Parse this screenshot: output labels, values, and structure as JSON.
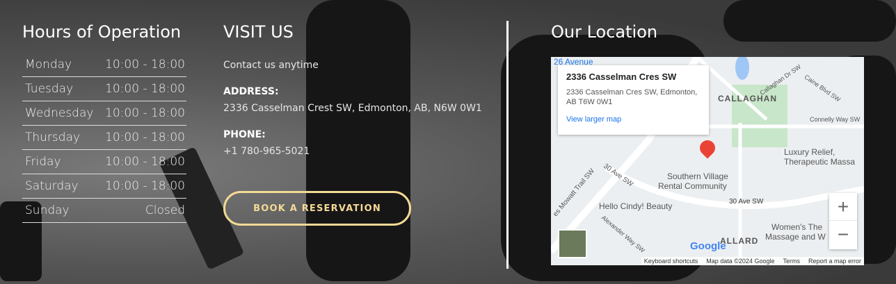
{
  "hours": {
    "title": "Hours of Operation",
    "rows": [
      {
        "day": "Monday",
        "time": "10:00 - 18:00"
      },
      {
        "day": "Tuesday",
        "time": "10:00 - 18:00"
      },
      {
        "day": "Wednesday",
        "time": "10:00 - 18:00"
      },
      {
        "day": "Thursday",
        "time": "10:00 - 18:00"
      },
      {
        "day": "Friday",
        "time": "10:00 - 18:00"
      },
      {
        "day": "Saturday",
        "time": "10:00 - 18:00"
      },
      {
        "day": "Sunday",
        "time": "Closed"
      }
    ]
  },
  "visit": {
    "title": "VISIT US",
    "subtitle": "Contact us anytime",
    "address_label": "ADDRESS:",
    "address": "2336 Casselman Crest SW, Edmonton, AB, N6W 0W1",
    "phone_label": "PHONE:",
    "phone": "+1 780-965-5021",
    "button": "BOOK A RESERVATION",
    "accent": "#f5d995"
  },
  "location": {
    "title": "Our Location",
    "map": {
      "card_title": "2336 Casselman Cres SW",
      "card_address_1": "2336 Casselman Cres SW, Edmonton,",
      "card_address_2": "AB T6W 0W1",
      "view_larger": "View larger map",
      "labels": [
        "26 Avenue",
        "CALLAGHAN",
        "Callaghan Dr SW",
        "Caine Blvd SW",
        "Connelly Way SW",
        "Luxury Relief,",
        "Therapeutic Massa",
        "Southern Village",
        "Rental Community",
        "30 Ave SW",
        "30 Ave SW",
        "Hello Cindy! Beauty",
        "es Mowatt Trail SW",
        "Alexander Way SW",
        "Women's The",
        "Massage and W",
        "ALLARD"
      ],
      "zoom_in": "+",
      "zoom_out": "−",
      "logo": "Google",
      "footer": [
        "Keyboard shortcuts",
        "Map data ©2024 Google",
        "Terms",
        "Report a map error"
      ]
    }
  }
}
